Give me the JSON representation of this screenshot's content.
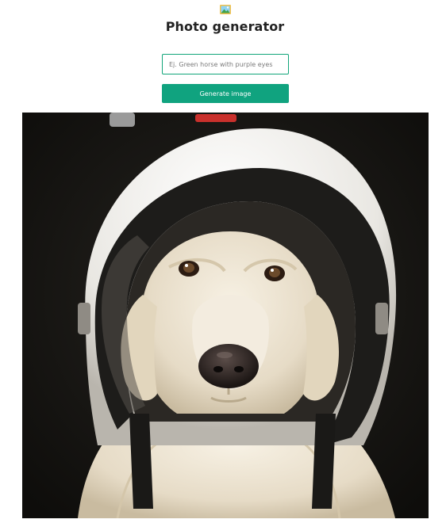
{
  "header": {
    "app_icon": "framed-picture-icon",
    "title": "Photo generator"
  },
  "form": {
    "prompt_placeholder": "Ej. Green horse with purple eyes",
    "prompt_value": "",
    "generate_label": "Generate image"
  },
  "result": {
    "image_subject": "white-dog-wearing-helmet-image"
  },
  "colors": {
    "accent": "#10a37f",
    "title_text": "#222222",
    "image_background": "#141310"
  }
}
